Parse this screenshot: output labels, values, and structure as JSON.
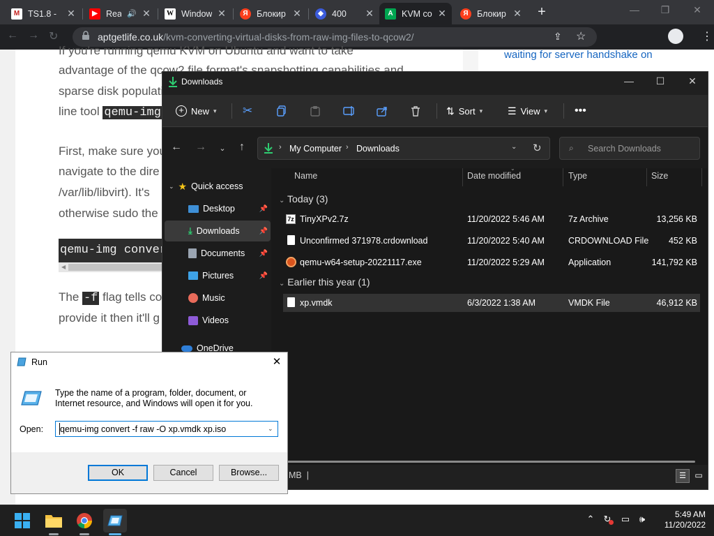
{
  "browser": {
    "tabs": [
      {
        "title": "TS1.8 -",
        "favicon": "gmail-icon",
        "color": "#ffffff"
      },
      {
        "title": "Rea",
        "favicon": "youtube-icon",
        "color": "#ff0000"
      },
      {
        "title": "Window",
        "favicon": "wikipedia-icon",
        "color": "#ffffff"
      },
      {
        "title": "Блокир",
        "favicon": "yandex-icon",
        "color": "#fc3f1d"
      },
      {
        "title": "400",
        "favicon": "web-icon",
        "color": "#5b8def"
      },
      {
        "title": "KVM co",
        "favicon": "kvm-icon",
        "color": "#00a651",
        "active": true
      },
      {
        "title": "Блокир",
        "favicon": "yandex-icon",
        "color": "#fc3f1d"
      }
    ],
    "url_domain": "aptgetlife.co.uk",
    "url_path": "/kvm-converting-virtual-disks-from-raw-img-files-to-qcow2/"
  },
  "webpage": {
    "line1": "If you're running qemu KVM on Ubuntu and want to take",
    "line2": "advantage of the qcow2 file format's snapshotting capabilities and",
    "line3": "sparse disk populati",
    "line4_prefix": "line tool ",
    "line4_code": "qemu-img",
    "line5": "First, make sure you",
    "line6": "navigate to the dire",
    "line7": "/var/lib/libvirt). It's",
    "line8": "otherwise sudo the",
    "code_block": "qemu-img conver",
    "line9_prefix": "The ",
    "line9_code": "-f",
    "line9_suffix": " flag tells con",
    "line10": "provide it then it'll g",
    "sidebar_text": "waiting for server handshake on"
  },
  "explorer": {
    "title": "Downloads",
    "toolbar": {
      "new": "New",
      "sort": "Sort",
      "view": "View"
    },
    "breadcrumb": [
      "My Computer",
      "Downloads"
    ],
    "search_placeholder": "Search Downloads",
    "nav": {
      "quick_access": "Quick access",
      "items": [
        {
          "label": "Desktop",
          "icon": "desktop-icon"
        },
        {
          "label": "Downloads",
          "icon": "download-icon"
        },
        {
          "label": "Documents",
          "icon": "documents-icon"
        },
        {
          "label": "Pictures",
          "icon": "pictures-icon"
        },
        {
          "label": "Music",
          "icon": "music-icon"
        },
        {
          "label": "Videos",
          "icon": "videos-icon"
        }
      ],
      "onedrive": "OneDrive"
    },
    "columns": {
      "name": "Name",
      "date": "Date modified",
      "type": "Type",
      "size": "Size"
    },
    "groups": [
      {
        "label": "Today (3)",
        "files": [
          {
            "name": "TinyXPv2.7z",
            "date": "11/20/2022 5:46 AM",
            "type": "7z Archive",
            "size": "13,256 KB"
          },
          {
            "name": "Unconfirmed 371978.crdownload",
            "date": "11/20/2022 5:40 AM",
            "type": "CRDOWNLOAD File",
            "size": "452 KB"
          },
          {
            "name": "qemu-w64-setup-20221117.exe",
            "date": "11/20/2022 5:29 AM",
            "type": "Application",
            "size": "141,792 KB"
          }
        ]
      },
      {
        "label": "Earlier this year (1)",
        "files": [
          {
            "name": "xp.vmdk",
            "date": "6/3/2022 1:38 AM",
            "type": "VMDK File",
            "size": "46,912 KB"
          }
        ]
      }
    ],
    "status_fragment": "MB  |"
  },
  "run_dialog": {
    "title": "Run",
    "description": "Type the name of a program, folder, document, or Internet resource, and Windows will open it for you.",
    "open_label": "Open:",
    "input_value": "qemu-img convert -f raw -O xp.vmdk xp.iso",
    "ok": "OK",
    "cancel": "Cancel",
    "browse": "Browse..."
  },
  "taskbar": {
    "time": "5:49 AM",
    "date": "11/20/2022"
  }
}
